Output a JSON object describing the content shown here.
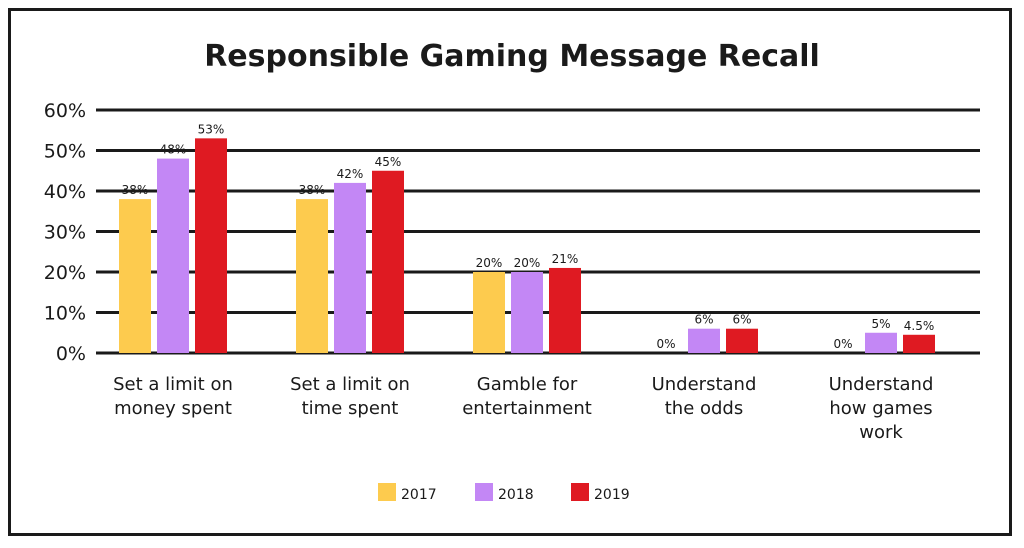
{
  "chart_data": {
    "type": "bar",
    "title": "Responsible Gaming Message Recall",
    "xlabel": "",
    "ylabel": "",
    "ylim": [
      0,
      60
    ],
    "yticks": [
      0,
      10,
      20,
      30,
      40,
      50,
      60
    ],
    "ytick_labels": [
      "0%",
      "10%",
      "20%",
      "30%",
      "40%",
      "50%",
      "60%"
    ],
    "grid": true,
    "legend_position": "bottom-center",
    "categories": [
      [
        "Set a limit on",
        "money spent"
      ],
      [
        "Set a limit on",
        "time spent"
      ],
      [
        "Gamble for",
        "entertainment"
      ],
      [
        "Understand",
        "the odds"
      ],
      [
        "Understand",
        "how games",
        "work"
      ]
    ],
    "series": [
      {
        "name": "2017",
        "color": "#FDCB4E",
        "values": [
          38,
          38,
          20,
          0,
          0
        ],
        "labels": [
          "38%",
          "38%",
          "20%",
          "0%",
          "0%"
        ]
      },
      {
        "name": "2018",
        "color": "#C387F5",
        "values": [
          48,
          42,
          20,
          6,
          5
        ],
        "labels": [
          "48%",
          "42%",
          "20%",
          "6%",
          "5%"
        ]
      },
      {
        "name": "2019",
        "color": "#DF1A22",
        "values": [
          53,
          45,
          21,
          6,
          4.5
        ],
        "labels": [
          "53%",
          "45%",
          "21%",
          "6%",
          "4.5%"
        ]
      }
    ]
  }
}
